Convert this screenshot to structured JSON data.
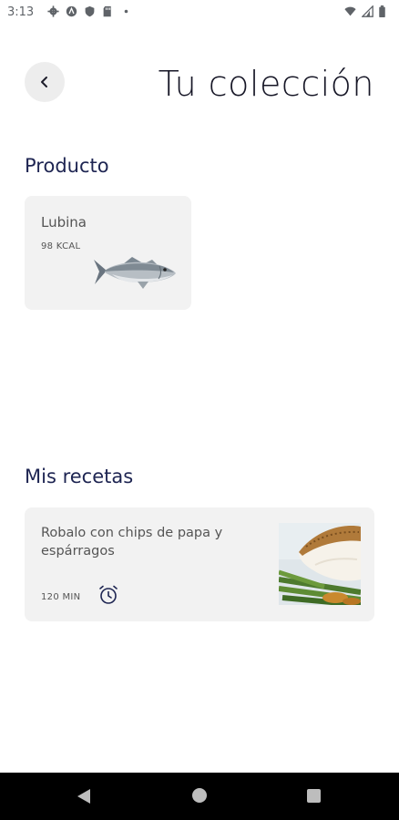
{
  "status_bar": {
    "time": "3:13",
    "left_icons": [
      "settings-icon",
      "vpn-icon",
      "shield-icon",
      "sd-card-icon",
      "dot-icon"
    ],
    "right_icons": [
      "wifi-icon",
      "signal-icon",
      "battery-icon"
    ]
  },
  "header": {
    "back_icon": "chevron-left-icon",
    "title": "Tu colección"
  },
  "product_section": {
    "title": "Producto",
    "items": [
      {
        "name": "Lubina",
        "kcal": "98 KCAL",
        "image": "fish-image"
      }
    ]
  },
  "recipes_section": {
    "title": "Mis recetas",
    "items": [
      {
        "name": "Robalo con chips de papa y espárragos",
        "time": "120 MIN",
        "icon": "alarm-clock-icon",
        "image": "grilled-fish-image"
      }
    ]
  },
  "colors": {
    "background": "#ffffff",
    "card": "#f2f2f2",
    "title_navy": "#1e2552",
    "nav_bar": "#000000"
  }
}
